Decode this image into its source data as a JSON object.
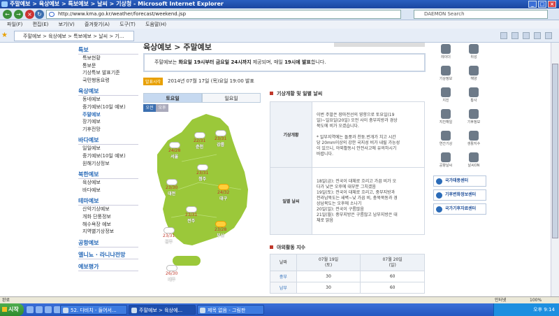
{
  "window": {
    "title": "주말예보 > 육상예보 > 특보예보 > 날씨 > 기상청 - Microsoft Internet Explorer"
  },
  "address": {
    "url": "http://www.kma.go.kr/weather/forecast/weekend.jsp",
    "search_placeholder": "DAEMON Search"
  },
  "menu": {
    "items": [
      "파일(F)",
      "편집(E)",
      "보기(V)",
      "즐겨찾기(A)",
      "도구(T)",
      "도움말(H)"
    ]
  },
  "favorites": {
    "tab_title": "주말예보 > 육상예보 > 특보예보 > 날씨 > 기..."
  },
  "nav": {
    "groups": [
      {
        "title": "특보",
        "items": [
          "특보현황",
          "통보문",
          "기상특보 발표기준",
          "국민행동요령"
        ]
      },
      {
        "title": "육상예보",
        "items": [
          "동네예보",
          "중기예보(10일 예보)",
          "주말예보",
          "장기예보",
          "기후전망"
        ]
      },
      {
        "title": "바다예보",
        "items": [
          "일일예보",
          "중기예보(10일 예보)",
          "원해기상정보"
        ]
      },
      {
        "title": "북한예보",
        "items": [
          "육상예보",
          "바다예보"
        ]
      },
      {
        "title": "테마예보",
        "items": [
          "산악기상예보",
          "개화 단풍정보",
          "해수욕장 예보",
          "지역별기상정보"
        ]
      },
      {
        "title": "공항예보",
        "items": []
      },
      {
        "title": "엘니뇨 · 라니냐전망",
        "items": []
      },
      {
        "title": "예보평가",
        "items": []
      }
    ],
    "active_item": "주말예보"
  },
  "main": {
    "heading": "육상예보 > 주말예보",
    "notice_prefix": "주말예보는 ",
    "notice_bold1": "화요일 19시부터 금요일 24시까지",
    "notice_mid": " 제공되며, 매일 ",
    "notice_bold2": "19시에 발표",
    "notice_suffix": "합니다.",
    "date_badge": "발표시각",
    "date_text": "2014년 07월 17일 (목)요일 19:00 발표",
    "day_tabs": [
      "토요일",
      "일요일"
    ],
    "ampm": [
      "오전",
      "오후"
    ]
  },
  "map": {
    "cities": [
      {
        "name": "서울",
        "temp": "24/28",
        "icon": "cloud"
      },
      {
        "name": "춘천",
        "temp": "22/31",
        "icon": "cloud"
      },
      {
        "name": "강릉",
        "temp": "23/31",
        "icon": "cloud"
      },
      {
        "name": "청주",
        "temp": "23/31",
        "icon": "cloud"
      },
      {
        "name": "대전",
        "temp": "23/30",
        "icon": "cloud"
      },
      {
        "name": "대구",
        "temp": "24/32",
        "icon": "sun"
      },
      {
        "name": "전주",
        "temp": "23/31",
        "icon": "cloud"
      },
      {
        "name": "광주",
        "temp": "23/31",
        "icon": "cloud"
      },
      {
        "name": "부산",
        "temp": "23/28",
        "icon": "sun"
      },
      {
        "name": "제주",
        "temp": "26/30",
        "icon": "cloud"
      }
    ]
  },
  "weather": {
    "section_title": "기상개황 및 일별 날씨",
    "overview_label": "기상개황",
    "overview_lines": [
      "이번 주말은 장마전선의 영향으로 토요일(19",
      "일)~일요일(20일) 오전 사이 충부지방과 경상",
      "북도에 비가 오겠습니다.",
      "",
      "* 일부지역에는 돌풍과 천둥.번개가 치고 시간",
      "당 20mm이상의 강한 국지성 비가 내릴 가능성",
      "이 있으니, 야외활동시 안전사고에 유의하시기",
      "바랍니다."
    ],
    "daily_label": "일별 날씨",
    "daily_lines": [
      "18일(금): 전국이 대체로 흐리고 가끔 비가 오",
      "다가 낮은 오후에 대부분 그치겠음",
      "19일(토): 전국이 대체로 흐리고, 중부지방과",
      "전라남북도는 새벽~낮 가끔 비, 충북북동과 경",
      "상남북도는 오후에 소나기",
      "20일(일): 전국이 구름많음",
      "21일(월): 중부지방은 구름많고 남부지방은 대",
      "체로 맑음"
    ]
  },
  "activity": {
    "section_title": "야외활동 지수",
    "header": [
      "날짜",
      "07월 19일",
      "(토)",
      "07월 20일",
      "(일)"
    ],
    "rows": [
      {
        "region": "중부",
        "d1": "30",
        "d2": "60"
      },
      {
        "region": "남부",
        "d1": "30",
        "d2": "60"
      }
    ]
  },
  "right_menu": {
    "icons": [
      "레이더",
      "위성",
      "기상정보",
      "해양",
      "지진",
      "황사",
      "지진해일",
      "기후정보",
      "연간기상",
      "생활지수",
      "공항날씨",
      "날씨ON"
    ],
    "banners": [
      "국가태풍센터",
      "기후변화정보센터",
      "국가기후자료센터"
    ]
  },
  "statusbar": {
    "left": "완료",
    "zone": "인터넷",
    "zoom": "100%"
  },
  "taskbar": {
    "start": "시작",
    "buttons": [
      "52. 다비치 - 들어서...",
      "주말예보 > 육상예...",
      "제목 없음 - 그림판"
    ],
    "clock": "오후 9:14"
  },
  "colors": {
    "map_green": "#9bc83a",
    "accent_blue": "#2a6bb8",
    "title_bar": "#1a46a0"
  }
}
